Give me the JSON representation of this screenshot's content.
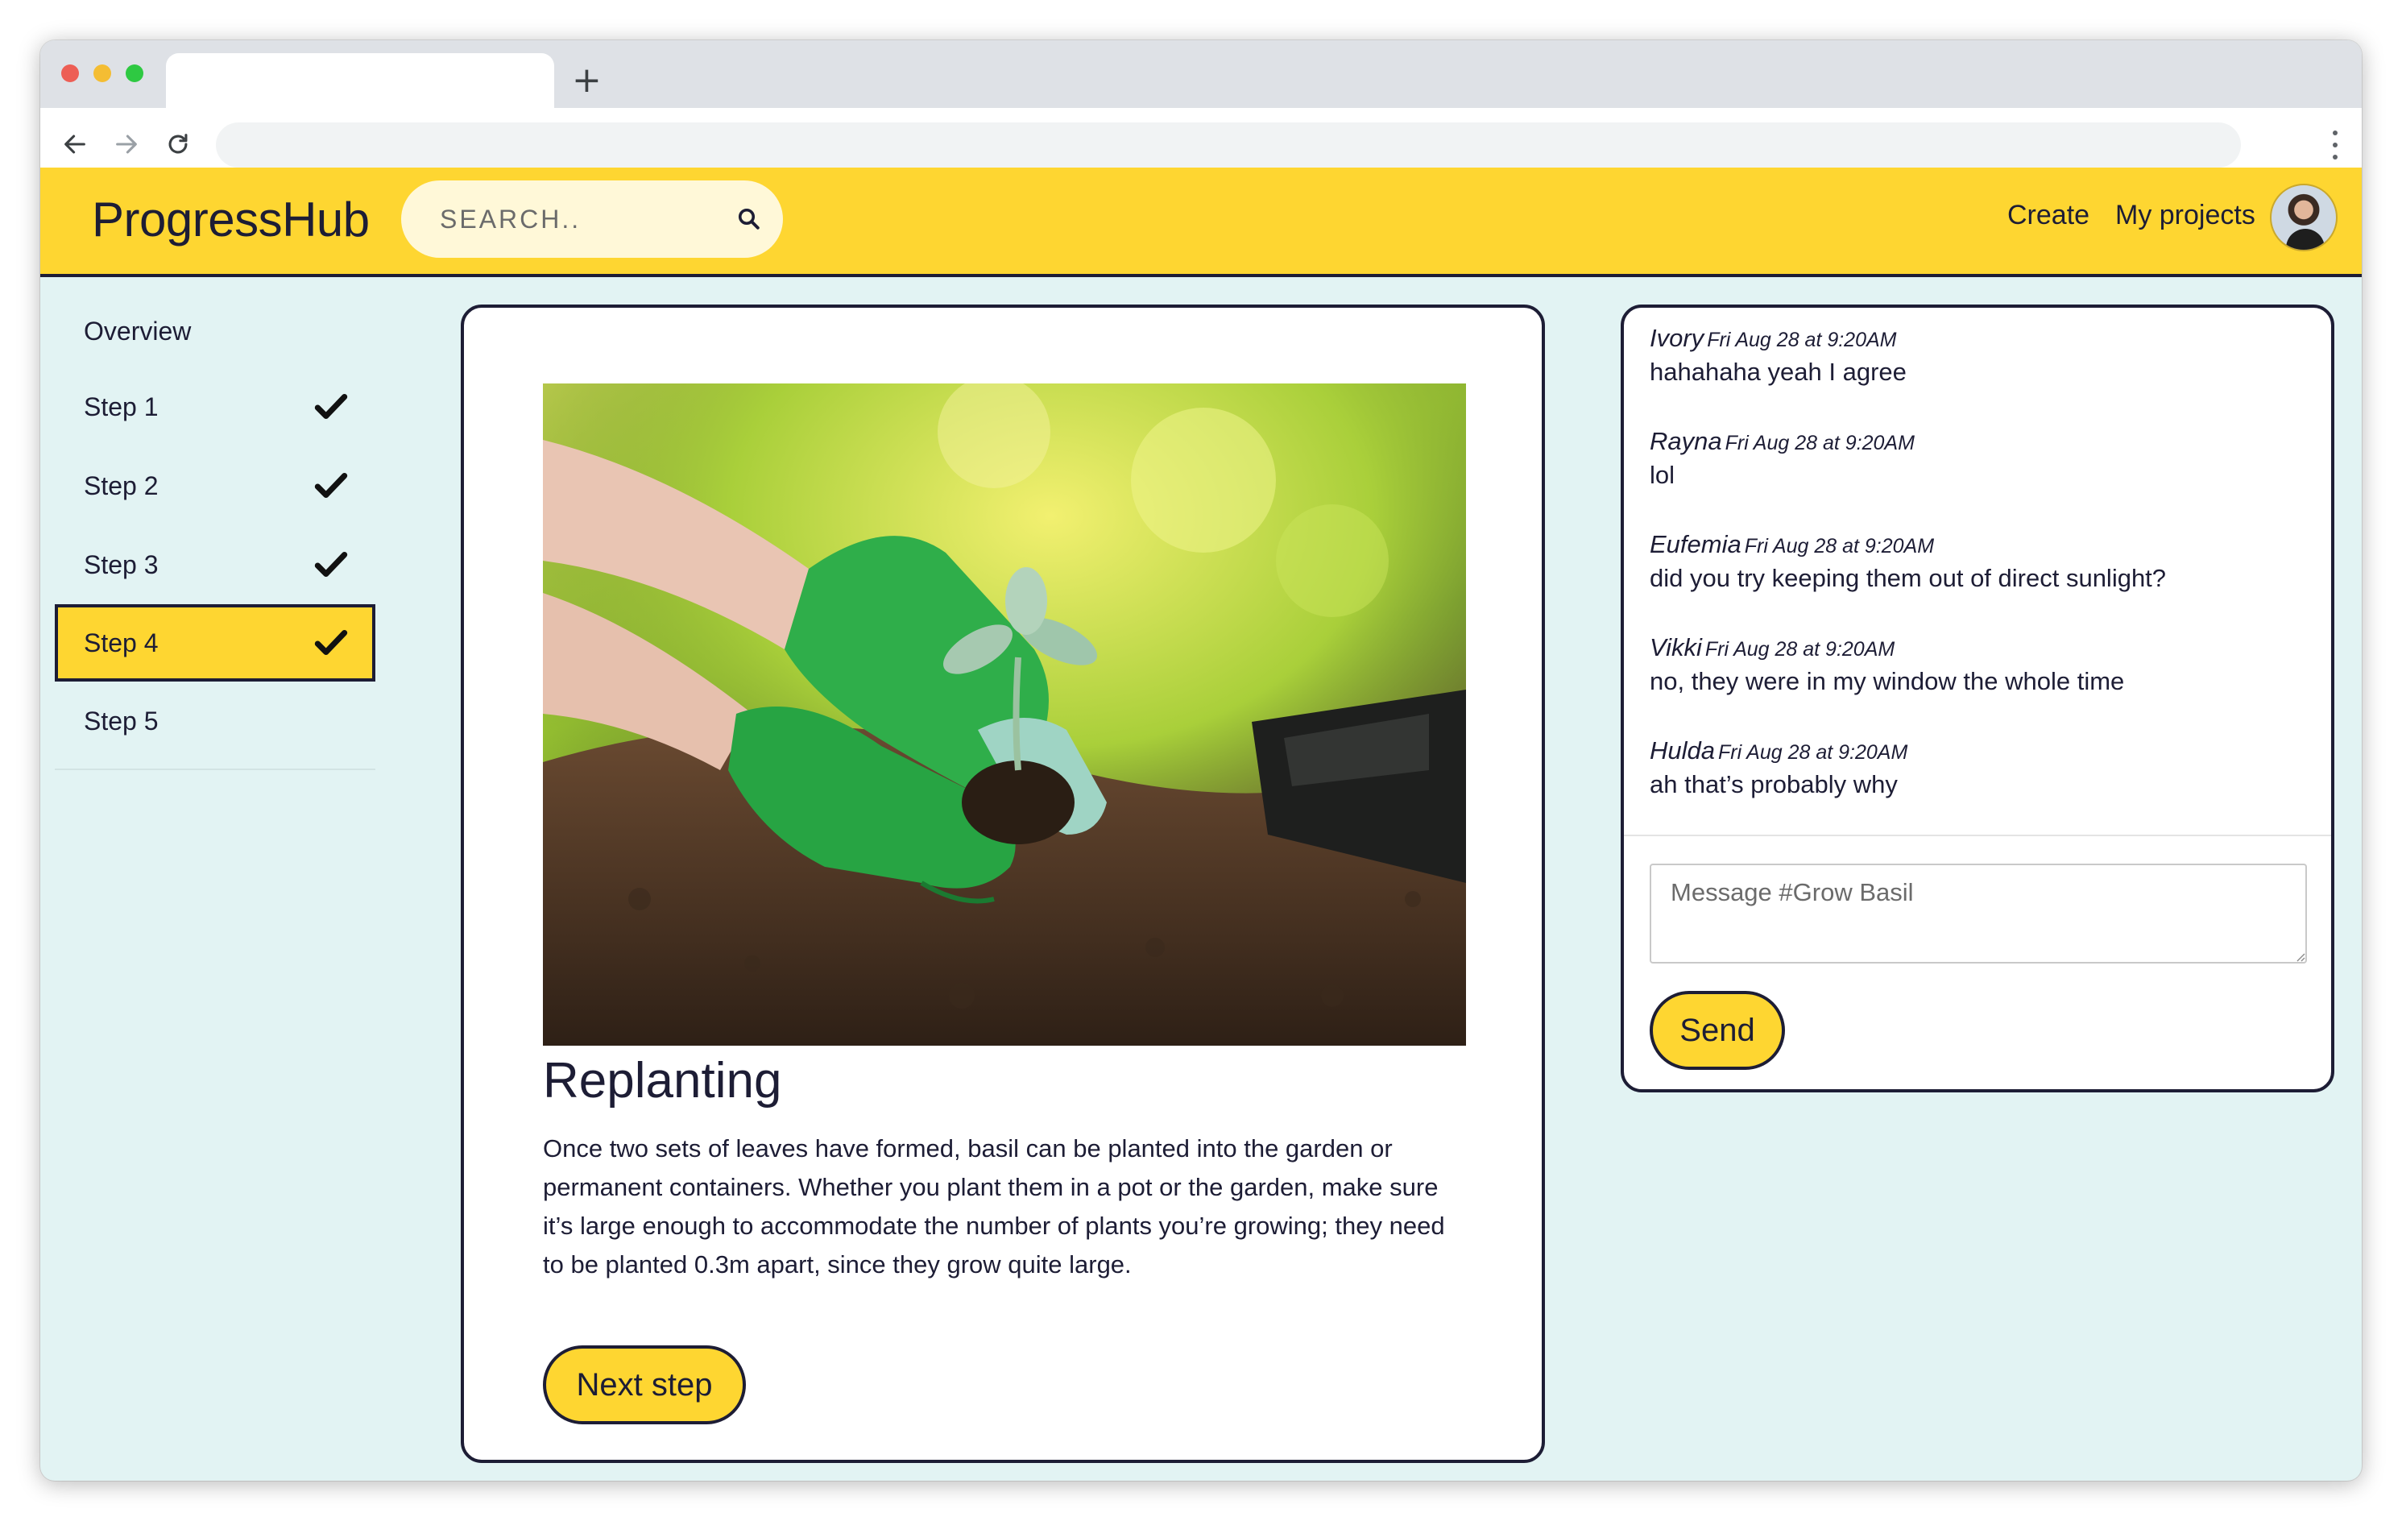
{
  "browser": {
    "new_tab_symbol": "+"
  },
  "header": {
    "logo": "ProgressHub",
    "search_placeholder": "SEARCH..",
    "create_label": "Create",
    "projects_label": "My projects",
    "brand_color": "#fed631"
  },
  "sidebar": {
    "overview_label": "Overview",
    "steps": [
      {
        "label": "Step 1",
        "completed": true,
        "active": false
      },
      {
        "label": "Step 2",
        "completed": true,
        "active": false
      },
      {
        "label": "Step 3",
        "completed": true,
        "active": false
      },
      {
        "label": "Step 4",
        "completed": true,
        "active": true
      },
      {
        "label": "Step 5",
        "completed": false,
        "active": false
      }
    ]
  },
  "step": {
    "image_alt": "Gloved hands replanting a basil seedling into soil",
    "title": "Replanting",
    "body": "Once two sets of leaves have formed, basil can be planted into the garden or permanent containers. Whether you plant them in a pot or the garden, make sure it’s large enough to accommodate the number of plants you’re growing; they need to be planted 0.3m apart, since they grow quite large.",
    "next_label": "Next step"
  },
  "chat": {
    "messages": [
      {
        "author": "Ivory",
        "time": "Fri Aug 28 at 9:20AM",
        "text": "hahahaha yeah I agree"
      },
      {
        "author": "Rayna",
        "time": "Fri Aug 28 at 9:20AM",
        "text": "lol"
      },
      {
        "author": "Eufemia",
        "time": "Fri Aug 28 at 9:20AM",
        "text": "did you try keeping them out of direct sunlight?"
      },
      {
        "author": "Vikki",
        "time": "Fri Aug 28 at 9:20AM",
        "text": "no, they were in my window the whole time"
      },
      {
        "author": "Hulda",
        "time": "Fri Aug 28 at 9:20AM",
        "text": "ah that’s probably why"
      }
    ],
    "input_placeholder": "Message #Grow Basil",
    "send_label": "Send"
  }
}
